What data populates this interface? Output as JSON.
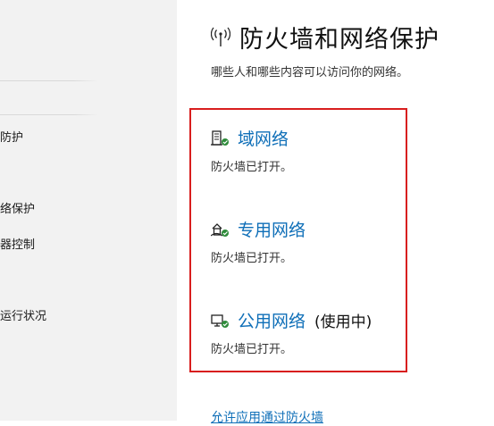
{
  "sidebar": {
    "items": [
      {
        "label": "防护"
      },
      {
        "label": "络保护"
      },
      {
        "label": "器控制"
      },
      {
        "label": "运行状况"
      }
    ]
  },
  "header": {
    "icon": "antenna-icon",
    "title": "防火墙和网络保护",
    "subtitle": "哪些人和哪些内容可以访问你的网络。"
  },
  "networks": [
    {
      "icon": "domain-network-icon",
      "name": "域网络",
      "suffix": "",
      "status": "防火墙已打开。"
    },
    {
      "icon": "private-network-icon",
      "name": "专用网络",
      "suffix": "",
      "status": "防火墙已打开。"
    },
    {
      "icon": "public-network-icon",
      "name": "公用网络",
      "suffix": "(使用中)",
      "status": "防火墙已打开。"
    }
  ],
  "links": {
    "allow_app": "允许应用通过防火墙"
  },
  "colors": {
    "link": "#0f6fb8",
    "highlight": "#d81e1e",
    "sidebar_bg": "#f2f2f2",
    "status_ok": "#2e8b3a"
  }
}
